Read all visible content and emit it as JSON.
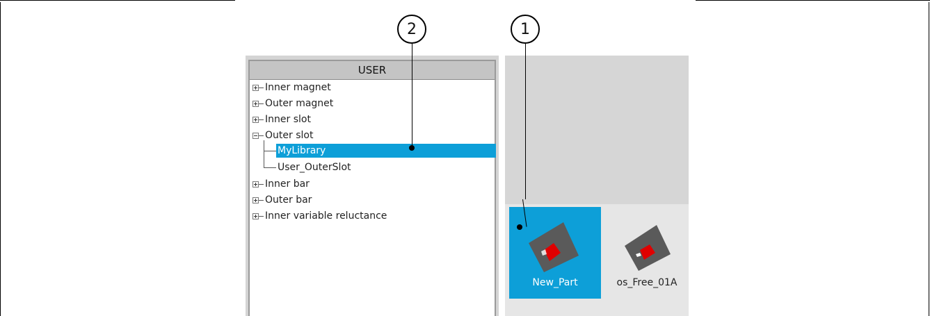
{
  "tree": {
    "header": "USER",
    "items": [
      {
        "label": "Inner magnet",
        "state": "collapsed"
      },
      {
        "label": "Outer magnet",
        "state": "collapsed"
      },
      {
        "label": "Inner slot",
        "state": "collapsed"
      },
      {
        "label": "Outer slot",
        "state": "expanded"
      },
      {
        "label": "Inner bar",
        "state": "collapsed"
      },
      {
        "label": "Outer bar",
        "state": "collapsed"
      },
      {
        "label": "Inner variable reluctance",
        "state": "collapsed"
      }
    ],
    "children": [
      {
        "label": "MyLibrary",
        "selected": true
      },
      {
        "label": "User_OuterSlot",
        "selected": false
      }
    ],
    "selection_color": "#0d9fd8"
  },
  "preview": {
    "tiles": [
      {
        "label": "New_Part",
        "selected": true,
        "icon": "outer-slot-thumbnail-icon"
      },
      {
        "label": "os_Free_01A",
        "selected": false,
        "icon": "outer-slot-thumbnail-icon"
      }
    ]
  },
  "callouts": [
    {
      "number": "2"
    },
    {
      "number": "1"
    }
  ]
}
